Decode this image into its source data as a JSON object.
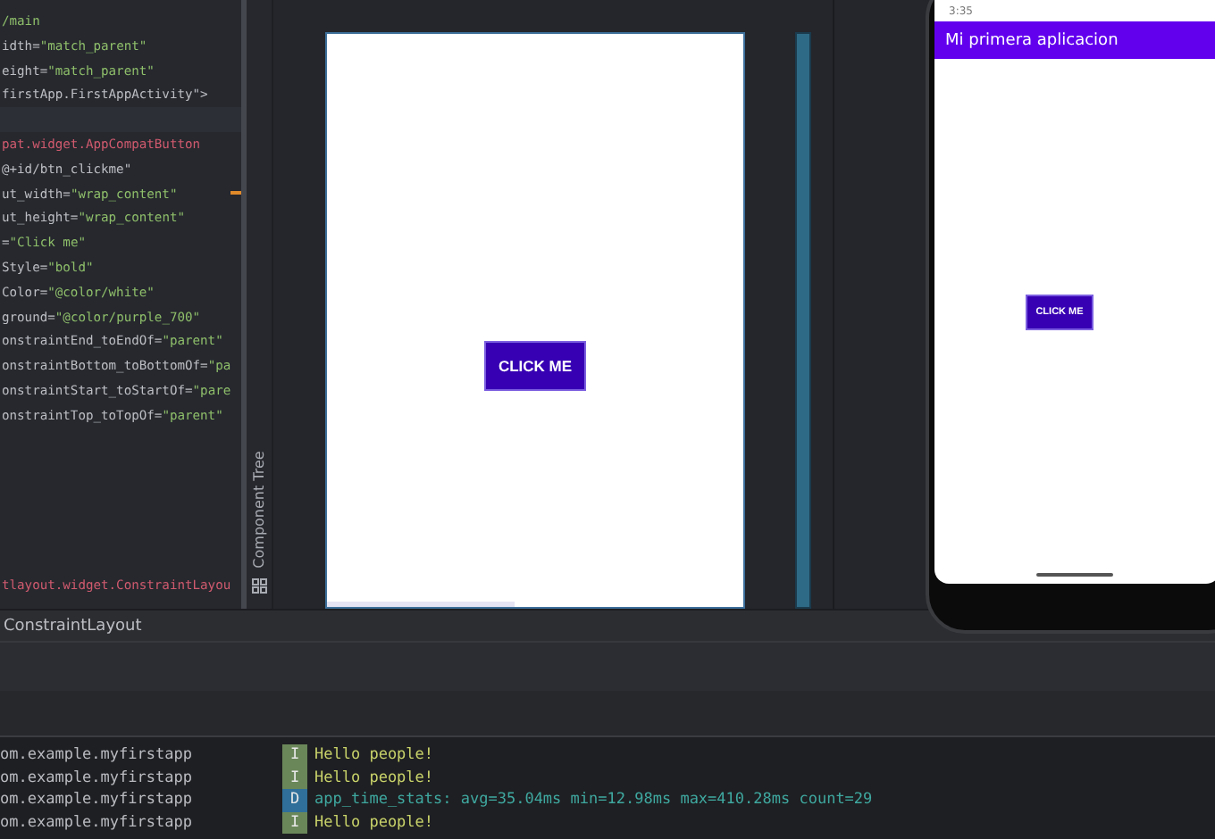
{
  "editor": {
    "lines": [
      {
        "kind": "text",
        "text": "/main"
      },
      {
        "kind": "attr",
        "name": "idth=",
        "value": "\"match_parent\""
      },
      {
        "kind": "attr",
        "name": "eight=",
        "value": "\"match_parent\""
      },
      {
        "kind": "attr",
        "name": "firstApp.FirstAppActivity\">"
      },
      {
        "kind": "blank"
      },
      {
        "kind": "tag",
        "text": "pat.widget.AppCompatButton"
      },
      {
        "kind": "attr",
        "name": "@+id/btn_clickme\""
      },
      {
        "kind": "attr",
        "name": "ut_width=",
        "value": "\"wrap_content\""
      },
      {
        "kind": "attr",
        "name": "ut_height=",
        "value": "\"wrap_content\""
      },
      {
        "kind": "attr",
        "name": "=",
        "value": "\"Click me\""
      },
      {
        "kind": "attr",
        "name": "Style=",
        "value": "\"bold\""
      },
      {
        "kind": "attr",
        "name": "Color=",
        "value": "\"@color/white\""
      },
      {
        "kind": "attr",
        "name": "ground=",
        "value": "\"@color/purple_700\""
      },
      {
        "kind": "attr",
        "name": "onstraintEnd_toEndOf=",
        "value": "\"parent\""
      },
      {
        "kind": "attr",
        "name": "onstraintBottom_toBottomOf=",
        "value": "\"pa"
      },
      {
        "kind": "attr",
        "name": "onstraintStart_toStartOf=",
        "value": "\"pare"
      },
      {
        "kind": "attr",
        "name": "onstraintTop_toTopOf=",
        "value": "\"parent\""
      }
    ],
    "closing_tag": "tlayout.widget.ConstraintLayou"
  },
  "component_tree": {
    "label": "Component Tree"
  },
  "design": {
    "button": "CLICK ME"
  },
  "emulator": {
    "time": "3:35",
    "app_title": "Mi primera aplicacion",
    "button": "CLICK ME"
  },
  "breadcrumb": "ConstraintLayout",
  "logcat": [
    {
      "package": "om.example.myfirstapp",
      "level": "I",
      "message": "Hello people!"
    },
    {
      "package": "om.example.myfirstapp",
      "level": "I",
      "message": "Hello people!"
    },
    {
      "package": "om.example.myfirstapp",
      "level": "D",
      "message": "app_time_stats: avg=35.04ms min=12.98ms max=410.28ms count=29"
    },
    {
      "package": "om.example.myfirstapp",
      "level": "I",
      "message": "Hello people!"
    }
  ]
}
